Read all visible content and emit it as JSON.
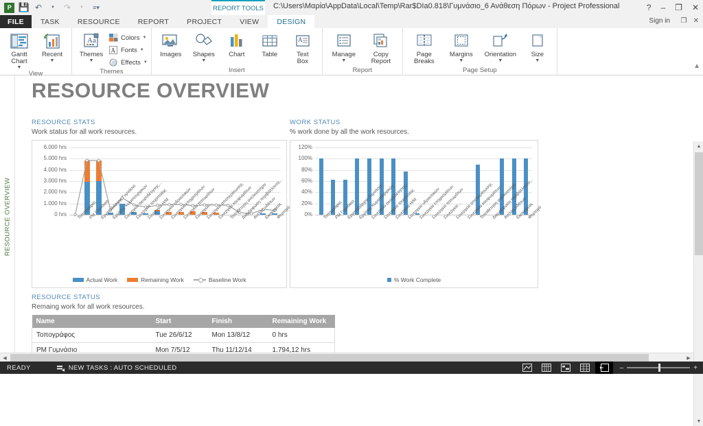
{
  "titlebar": {
    "app_logo": "P",
    "path": "C:\\Users\\Μαρία\\AppData\\Local\\Temp\\Rar$DIa0.818\\Γυμνάσιο_6 Ανάθεση Πόρων - Project Professional",
    "report_tools": "REPORT TOOLS",
    "help": "?",
    "minimize": "–",
    "restore": "❐",
    "close": "✕"
  },
  "tabs": {
    "file": "FILE",
    "items": [
      {
        "label": "TASK",
        "active": false
      },
      {
        "label": "RESOURCE",
        "active": false
      },
      {
        "label": "REPORT",
        "active": false
      },
      {
        "label": "PROJECT",
        "active": false
      },
      {
        "label": "VIEW",
        "active": false
      },
      {
        "label": "DESIGN",
        "active": true
      }
    ],
    "sign_in": "Sign in"
  },
  "ribbon": {
    "groups": [
      {
        "label": "View",
        "buttons": [
          {
            "name": "gantt-chart",
            "label": "Gantt\nChart",
            "caret": true
          },
          {
            "name": "recent",
            "label": "Recent",
            "caret": true
          }
        ]
      },
      {
        "label": "Themes",
        "buttons": [
          {
            "name": "themes",
            "label": "Themes",
            "caret": true
          }
        ],
        "small": [
          {
            "name": "colors",
            "label": "Colors"
          },
          {
            "name": "fonts",
            "label": "Fonts"
          },
          {
            "name": "effects",
            "label": "Effects"
          }
        ]
      },
      {
        "label": "Insert",
        "buttons": [
          {
            "name": "images",
            "label": "Images",
            "caret": false
          },
          {
            "name": "shapes",
            "label": "Shapes",
            "caret": true
          },
          {
            "name": "chart",
            "label": "Chart",
            "caret": false
          },
          {
            "name": "table",
            "label": "Table",
            "caret": false
          },
          {
            "name": "text-box",
            "label": "Text\nBox",
            "caret": false
          }
        ]
      },
      {
        "label": "Report",
        "buttons": [
          {
            "name": "manage",
            "label": "Manage",
            "caret": true
          },
          {
            "name": "copy-report",
            "label": "Copy\nReport",
            "caret": false
          }
        ]
      },
      {
        "label": "Page Setup",
        "buttons": [
          {
            "name": "page-breaks",
            "label": "Page\nBreaks",
            "caret": false
          },
          {
            "name": "margins",
            "label": "Margins",
            "caret": true
          },
          {
            "name": "orientation",
            "label": "Orientation",
            "caret": true
          },
          {
            "name": "size",
            "label": "Size",
            "caret": true
          }
        ]
      }
    ]
  },
  "sidebar_tab": "RESOURCE OVERVIEW",
  "report": {
    "title": "RESOURCE OVERVIEW",
    "resource_stats": {
      "heading": "RESOURCE STATS",
      "subtitle": "Work status for all work resources."
    },
    "work_status": {
      "heading": "WORK STATUS",
      "subtitle": "% work done by all the work resources."
    },
    "resource_status": {
      "heading": "RESOURCE STATUS",
      "subtitle": "Remaing work for all work resources.",
      "columns": [
        "Name",
        "Start",
        "Finish",
        "Remaining Work"
      ],
      "rows": [
        [
          "Τοπογράφος",
          "Tue 26/6/12",
          "Mon 13/8/12",
          "0 hrs"
        ],
        [
          "PM Γυμνάσιο",
          "Mon 7/5/12",
          "Thu 11/12/14",
          "1.794,12 hrs"
        ]
      ]
    }
  },
  "chart_data": [
    {
      "type": "bar",
      "id": "resource-stats-chart",
      "title": "RESOURCE STATS",
      "subtitle": "Work status for all work resources.",
      "xlabel": "",
      "ylabel": "",
      "ylim": [
        0,
        6000
      ],
      "yticks": [
        0,
        1000,
        2000,
        3000,
        4000,
        5000,
        6000
      ],
      "ytick_labels": [
        "0 hrs",
        "1.000 hrs",
        "2.000 hrs",
        "3.000 hrs",
        "4.000 hrs",
        "5.000 hrs",
        "6.000 hrs"
      ],
      "grid": true,
      "legend": [
        "Actual Work",
        "Remaining Work",
        "Baseline Work"
      ],
      "legend_position": "bottom",
      "colors": {
        "Actual Work": "#4a90c4",
        "Remaining Work": "#ed7d31",
        "Baseline Work": "#a6a6a6"
      },
      "stacked": true,
      "categories": [
        "Τοπογράφος",
        "PM Γυμνάσιο",
        "Εργοταξιάρχης Γυμνάσιο",
        "Εργάτες Χωματουργικών",
        "Συνεργείο σκυροδέτησης…",
        "Συνεργείο τοιχοποιίας",
        "Συνεργείο Η/Μ",
        "Συνεργείο υδραυλικών",
        "Συνεργείο επιχρισμάτων",
        "Συνεργείο πατωμάτων",
        "Συνεργείο…",
        "Συνεργείο αποπεράτωσης",
        "Συνεργείο κουφωμάτων",
        "Τοποθέτηση ανελκυστήρα",
        "Διαμόρφωση περιβάλλοντα…",
        "Αντλίες υδάτων",
        "Εκσκαφέας",
        "Φορτηγό"
      ],
      "series": [
        {
          "name": "Actual Work",
          "type": "bar",
          "values": [
            0,
            2950,
            2980,
            200,
            1000,
            260,
            140,
            330,
            0,
            0,
            0,
            0,
            0,
            0,
            0,
            0,
            100,
            130
          ]
        },
        {
          "name": "Remaining Work",
          "type": "bar",
          "values": [
            0,
            1900,
            1880,
            0,
            0,
            0,
            0,
            90,
            260,
            260,
            280,
            250,
            200,
            0,
            0,
            0,
            0,
            0
          ]
        },
        {
          "name": "Baseline Work",
          "type": "line",
          "values": [
            0,
            4850,
            4830,
            400,
            1500,
            880,
            680,
            840,
            900,
            920,
            800,
            880,
            860,
            840,
            190,
            90,
            480,
            400
          ]
        }
      ]
    },
    {
      "type": "bar",
      "id": "work-status-chart",
      "title": "WORK STATUS",
      "subtitle": "% work done by all the work resources.",
      "xlabel": "",
      "ylabel": "",
      "ylim": [
        0,
        120
      ],
      "yticks": [
        0,
        20,
        40,
        60,
        80,
        100,
        120
      ],
      "ytick_labels": [
        "0%",
        "20%",
        "40%",
        "60%",
        "80%",
        "100%",
        "120%"
      ],
      "grid": true,
      "legend": [
        "% Work Complete"
      ],
      "legend_position": "bottom",
      "colors": {
        "% Work Complete": "#4a90c4"
      },
      "categories": [
        "Τοπογράφος",
        "PM Γυμνάσιο",
        "Εργοταξιάρχης Γυμνάσιο",
        "Εργάτες Χωματουργικών",
        "Συνεργείο σκυροδέτησης…",
        "Συνεργείο τοιχοποιίας",
        "Συνεργείο Η/Μ",
        "Συνεργείο υδραυλικών",
        "Συνεργείο επιχρισμάτων",
        "Συνεργείο πατωμάτων",
        "Συνεργείο…",
        "Συνεργείο αποπεράτωσης",
        "Συνεργείο κουφωμάτων",
        "Τοποθέτηση ανελκυστήρα",
        "Διαμόρφωση περιβάλλοντα…",
        "Αντλίες υδάτων",
        "Εκσκαφέας",
        "Φορτηγό"
      ],
      "series": [
        {
          "name": "% Work Complete",
          "values": [
            100,
            62,
            62,
            100,
            100,
            100,
            100,
            77,
            3,
            0,
            0,
            0,
            0,
            89,
            0,
            100,
            100,
            100
          ]
        }
      ]
    }
  ],
  "statusbar": {
    "ready": "READY",
    "new_tasks": "NEW TASKS : AUTO SCHEDULED",
    "zoom_out": "–",
    "zoom_in": "+"
  }
}
